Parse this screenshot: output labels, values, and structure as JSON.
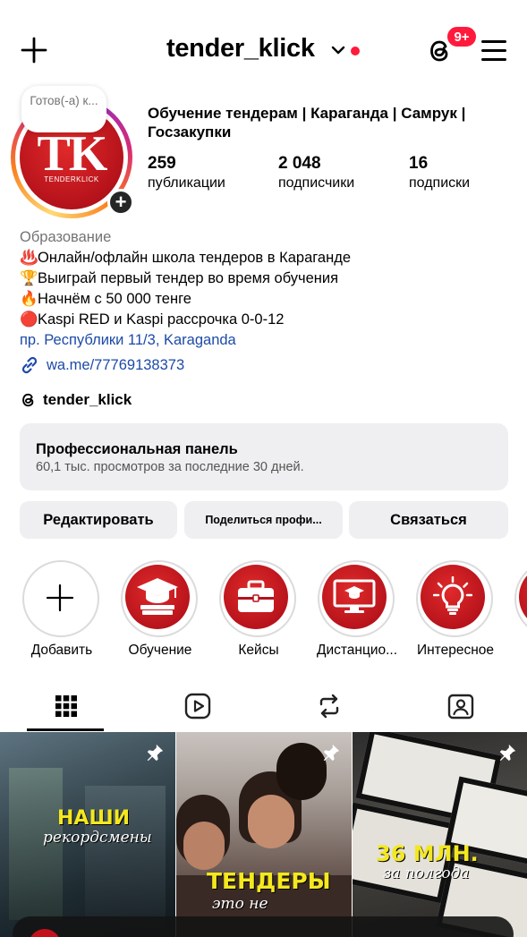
{
  "header": {
    "username": "tender_klick",
    "notification_badge": "9+"
  },
  "profile": {
    "note": "Готов(-а) к...",
    "avatar_logo": "TK",
    "avatar_sub": "TENDERKLICK",
    "name": "Обучение тендерам | Караганда | Самрук | Госзакупки",
    "stats": [
      {
        "value": "259",
        "label": "публикации"
      },
      {
        "value": "2 048",
        "label": "подписчики"
      },
      {
        "value": "16",
        "label": "подписки"
      }
    ]
  },
  "bio": {
    "category": "Образование",
    "lines": [
      {
        "emoji": "♨️",
        "text": "Онлайн/офлайн школа тендеров в Караганде"
      },
      {
        "emoji": "🏆",
        "text": "Выиграй первый тендер во время обучения"
      },
      {
        "emoji": "🔥",
        "text": "Начнём с 50 000 тенге"
      },
      {
        "emoji": "🔴",
        "text": "Kaspi RED и Kaspi рассрочка 0-0-12"
      }
    ],
    "address": "пр. Республики 11/3, Karaganda",
    "link": "wa.me/77769138373",
    "threads_handle": "tender_klick"
  },
  "pro_panel": {
    "title": "Профессиональная панель",
    "subtitle": "60,1 тыс. просмотров за последние 30 дней."
  },
  "actions": {
    "edit": "Редактировать",
    "share": "Поделиться профи...",
    "contact": "Связаться"
  },
  "highlights": [
    {
      "label": "Добавить",
      "icon": "plus-icon"
    },
    {
      "label": "Обучение",
      "icon": "graduation-cap-icon"
    },
    {
      "label": "Кейсы",
      "icon": "briefcase-icon"
    },
    {
      "label": "Дистанцио...",
      "icon": "monitor-icon"
    },
    {
      "label": "Интересное",
      "icon": "lightbulb-icon"
    }
  ],
  "tabs": [
    {
      "name": "grid",
      "icon": "grid-icon",
      "active": true
    },
    {
      "name": "reels",
      "icon": "reels-icon"
    },
    {
      "name": "reposts",
      "icon": "repost-icon"
    },
    {
      "name": "tagged",
      "icon": "tagged-icon"
    }
  ],
  "posts": [
    {
      "title": "НАШИ",
      "subtitle": "рекордсмены",
      "pinned": true
    },
    {
      "title": "ТЕНДЕРЫ",
      "subtitle": "это не",
      "pinned": true
    },
    {
      "title": "36 МЛН.",
      "subtitle": "за полгода",
      "pinned": true
    }
  ],
  "colors": {
    "accent_red": "#ff1a3c",
    "brand_red": "#b5121b",
    "link_blue": "#1c4aa8",
    "panel_bg": "#efeff2",
    "post_headline": "#f4e81e"
  }
}
